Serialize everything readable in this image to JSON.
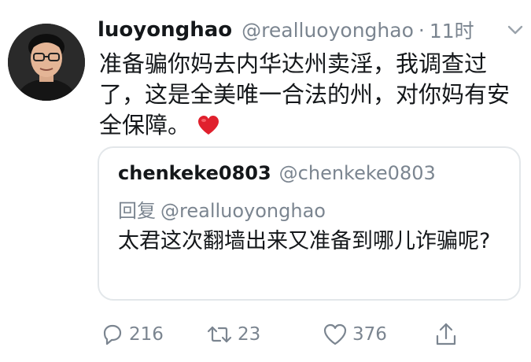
{
  "tweet": {
    "author_name": "luoyonghao",
    "author_handle": "@realluoyonghao",
    "separator": "·",
    "time": "11时",
    "text": "准备骗你妈去内华达州卖淫，我调查过了，这是全美唯一合法的州，对你妈有安全保障。",
    "emoji": "red-heart"
  },
  "quoted": {
    "author_name": "chenkeke0803",
    "author_handle": "@chenkeke0803",
    "reply_prefix": "回复",
    "reply_to": "@realluoyonghao",
    "text": "太君这次翻墙出来又准备到哪儿诈骗呢?"
  },
  "actions": {
    "reply_count": "216",
    "retweet_count": "23",
    "like_count": "376"
  },
  "icons": {
    "reply": "reply-icon",
    "retweet": "retweet-icon",
    "like": "like-icon",
    "share": "share-icon",
    "caret": "chevron-down-icon"
  },
  "colors": {
    "muted": "#7b8590",
    "text": "#14171a",
    "border": "#e3e7ea",
    "heart": "#e0202d"
  }
}
